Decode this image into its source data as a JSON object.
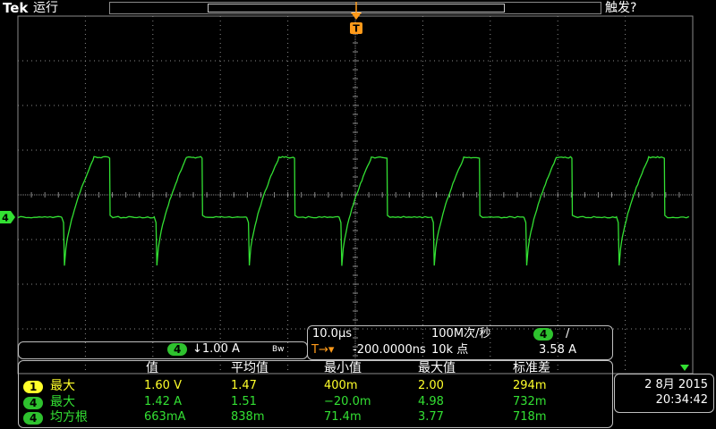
{
  "header": {
    "brand": "Tek",
    "run_state": "运行",
    "trigger_status": "触发?"
  },
  "trigger_marker": "T",
  "channel_marker": "4",
  "channel_settings": {
    "channel": "4",
    "scale": "↓1.00 A",
    "bandwidth_icon": "Bw"
  },
  "timebase": {
    "time_per_div": "10.0μs",
    "sample_rate": "100M次/秒",
    "trigger_channel": "4",
    "trigger_slope": "/",
    "delay_prefix": "T→▾",
    "delay": "-200.0000ns",
    "record_length": "10k 点",
    "trigger_level": "3.58 A"
  },
  "measurements": {
    "headers": [
      "值",
      "平均值",
      "最小值",
      "最大值",
      "标准差"
    ],
    "rows": [
      {
        "channel": "1",
        "name": "最大",
        "color": "#ffff2a",
        "values": [
          "1.60 V",
          "1.47",
          "400m",
          "2.00",
          "294m"
        ]
      },
      {
        "channel": "4",
        "name": "最大",
        "color": "#33e033",
        "values": [
          "1.42 A",
          "1.51",
          "−20.0m",
          "4.98",
          "732m"
        ]
      },
      {
        "channel": "4",
        "name": "均方根",
        "color": "#33e033",
        "values": [
          "663mA",
          "838m",
          "71.4m",
          "3.77",
          "718m"
        ]
      }
    ]
  },
  "datetime": {
    "date": "2 8月 2015",
    "time": "20:34:42"
  },
  "colors": {
    "ch1": "#ffff2a",
    "ch4": "#33e033",
    "trigger": "#ff9a1a",
    "grid": "#8a8a8a"
  }
}
